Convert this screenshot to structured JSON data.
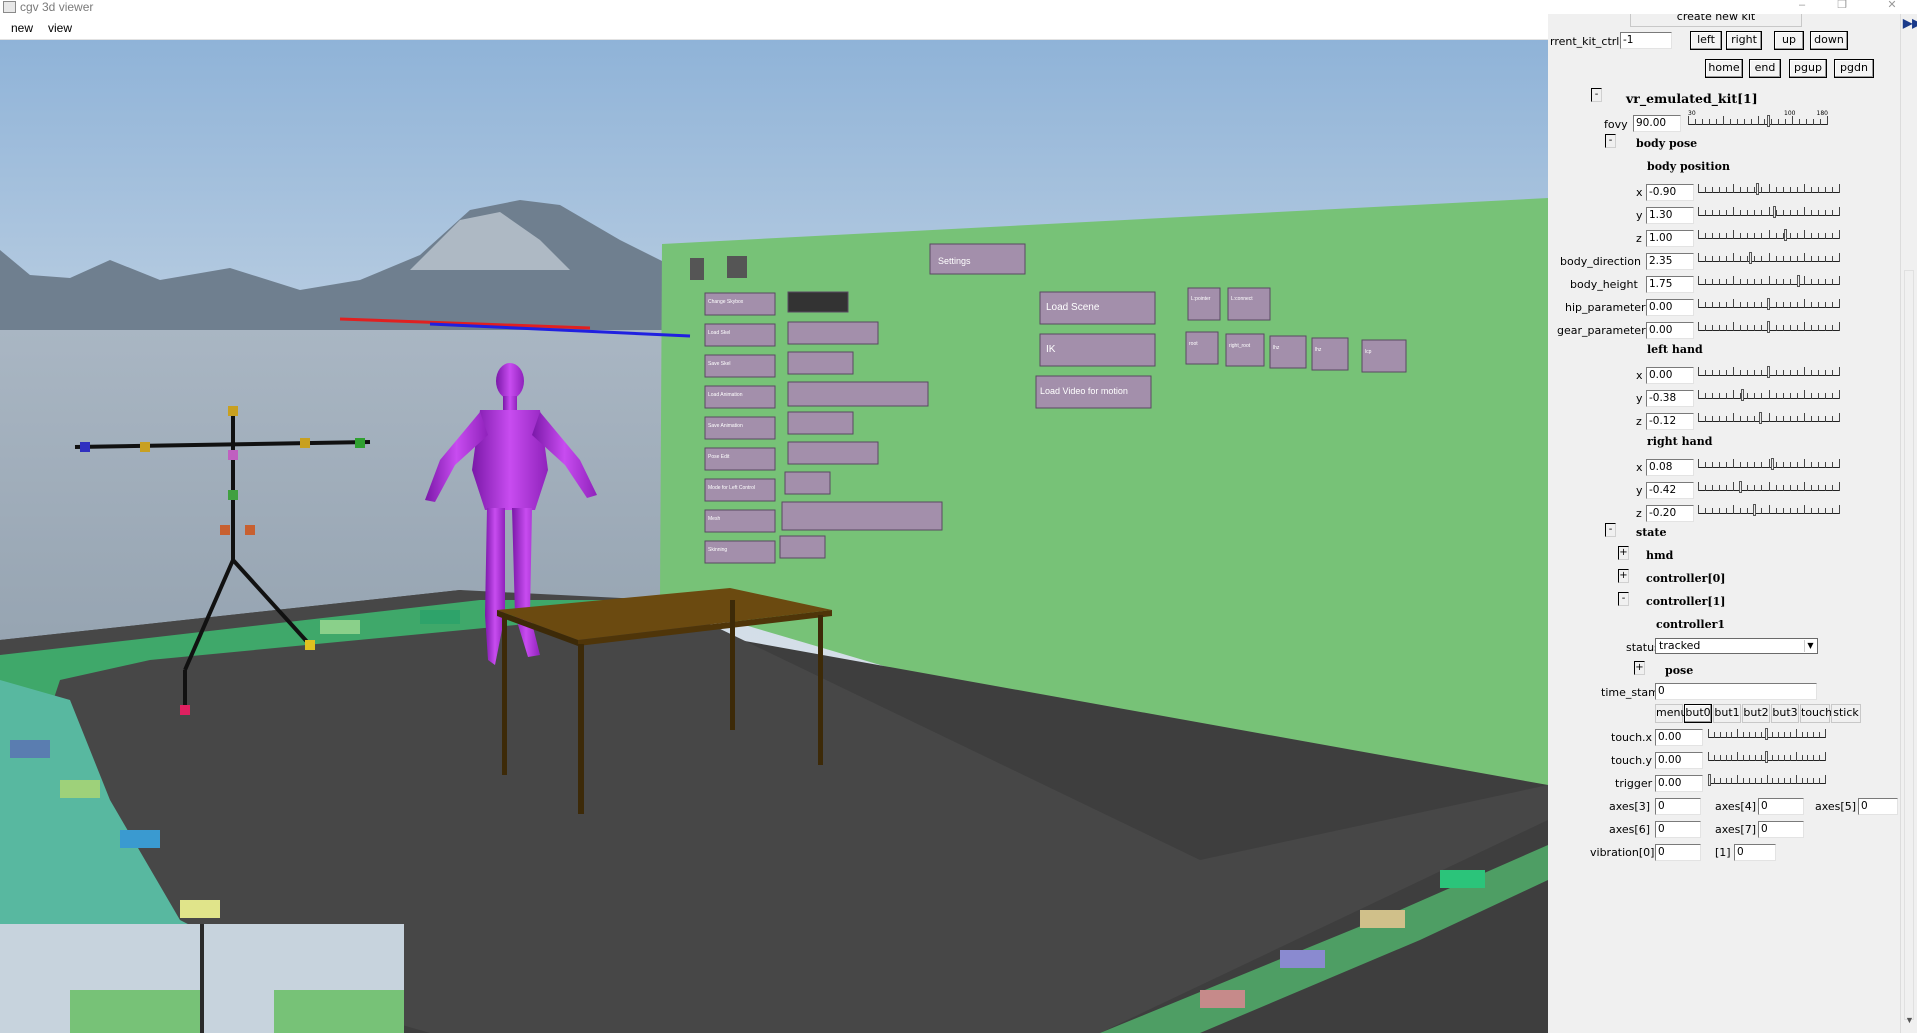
{
  "window": {
    "title": "cgv 3d viewer",
    "minimize_glyph": "–",
    "restore_glyph": "❐",
    "close_glyph": "✕"
  },
  "menu": {
    "items": [
      "new",
      "view"
    ]
  },
  "scene_buttons": {
    "settings": "Settings",
    "load_scene": "Load Scene",
    "ik": "IK",
    "load_video": "Load Video for motion",
    "change_skybox": "Change Skybox",
    "load_skel": "Load Skel",
    "save_skel": "Save Skel",
    "load_animation": "Load Animation",
    "save_animation": "Save Animation",
    "pose_edit": "Pose Edit",
    "mode_left_control": "Mode for Left Control",
    "mesh": "Mesh",
    "skinning": "Skinning",
    "small_top": [
      "L:pointer",
      "L:connect"
    ],
    "small_row": [
      "root",
      "right_root",
      "lhz",
      "lhz",
      "lcp"
    ]
  },
  "panel": {
    "create_new_kit": "create new kit",
    "current_kit_ctrl": {
      "label": "rrent_kit_ctrl",
      "value": "-1"
    },
    "nav_buttons": [
      "left",
      "right",
      "up",
      "down",
      "home",
      "end",
      "pgup",
      "pgdn"
    ],
    "kit_header": "vr_emulated_kit[1]",
    "fovy": {
      "label": "fovy",
      "value": "90.00",
      "min_label": "30",
      "mid_label": "100",
      "max_label": "180",
      "level": 0.58
    },
    "body_pose": {
      "header": "body pose",
      "position_header": "body position",
      "x": {
        "label": "x",
        "value": "-0.90",
        "level": 0.42
      },
      "y": {
        "label": "y",
        "value": "1.30",
        "level": 0.54
      },
      "z": {
        "label": "z",
        "value": "1.00",
        "level": 0.62
      },
      "body_direction": {
        "label": "body_direction",
        "value": "2.35",
        "level": 0.37
      },
      "body_height": {
        "label": "body_height",
        "value": "1.75",
        "level": 0.72
      },
      "hip_parameter": {
        "label": "hip_parameter",
        "value": "0.00",
        "level": 0.5
      },
      "gear_parameter": {
        "label": "gear_parameter",
        "value": "0.00",
        "level": 0.5
      }
    },
    "left_hand": {
      "header": "left hand",
      "x": {
        "label": "x",
        "value": "0.00",
        "level": 0.5
      },
      "y": {
        "label": "y",
        "value": "-0.38",
        "level": 0.31
      },
      "z": {
        "label": "z",
        "value": "-0.12",
        "level": 0.44
      }
    },
    "right_hand": {
      "header": "right hand",
      "x": {
        "label": "x",
        "value": "0.08",
        "level": 0.53
      },
      "y": {
        "label": "y",
        "value": "-0.42",
        "level": 0.3
      },
      "z": {
        "label": "z",
        "value": "-0.20",
        "level": 0.4
      }
    },
    "state": {
      "header": "state",
      "hmd": "hmd",
      "controller0": "controller[0]",
      "controller1": "controller[1]",
      "controller1_sub": "controller1",
      "status_label": "status",
      "status_value": "tracked",
      "pose": "pose",
      "time_stamp": {
        "label": "time_stamp",
        "value": "0"
      },
      "buttons": [
        "menu",
        "but0",
        "but1",
        "but2",
        "but3",
        "touch",
        "stick"
      ],
      "touch_x": {
        "label": "touch.x",
        "value": "0.00",
        "level": 0.5
      },
      "touch_y": {
        "label": "touch.y",
        "value": "0.00",
        "level": 0.5
      },
      "trigger": {
        "label": "trigger",
        "value": "0.00",
        "level": 0.0
      },
      "axes": [
        {
          "label": "axes[3]",
          "value": "0"
        },
        {
          "label": "axes[4]",
          "value": "0"
        },
        {
          "label": "axes[5]",
          "value": "0"
        },
        {
          "label": "axes[6]",
          "value": "0"
        },
        {
          "label": "axes[7]",
          "value": "0"
        }
      ],
      "vibration": [
        {
          "label": "vibration[0]",
          "value": "0"
        },
        {
          "label": "[1]",
          "value": "0"
        }
      ]
    }
  }
}
